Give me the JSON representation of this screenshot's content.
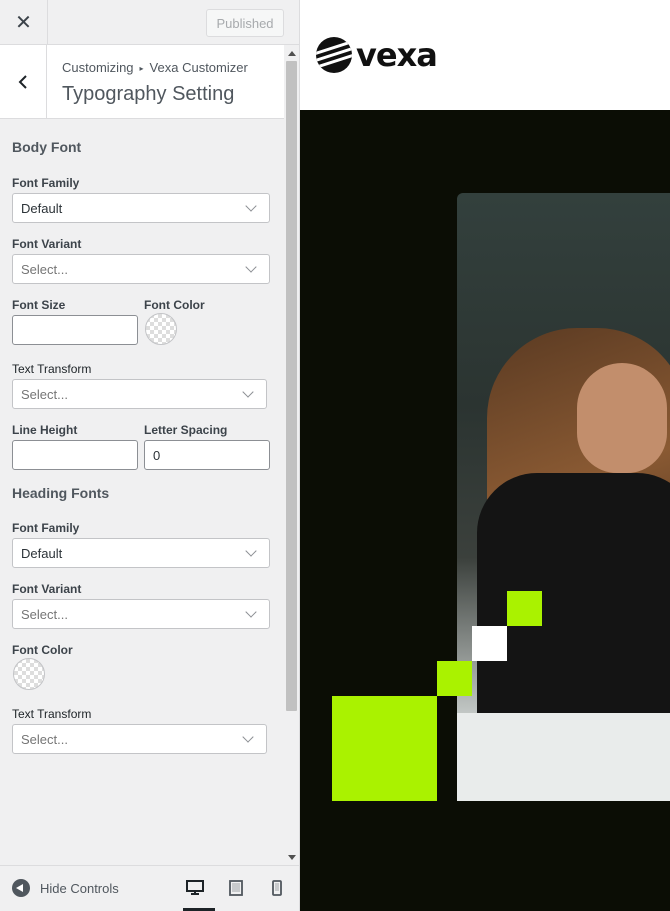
{
  "topbar": {
    "close_glyph": "✕",
    "publish_label": "Published"
  },
  "header": {
    "breadcrumb_root": "Customizing",
    "breadcrumb_sep": "▸",
    "breadcrumb_parent": "Vexa Customizer",
    "title": "Typography Setting"
  },
  "body_font": {
    "title": "Body Font",
    "font_family": {
      "label": "Font Family",
      "value": "Default"
    },
    "font_variant": {
      "label": "Font Variant",
      "placeholder": "Select..."
    },
    "font_size": {
      "label": "Font Size",
      "value": ""
    },
    "font_color": {
      "label": "Font Color"
    },
    "text_transform": {
      "label": "Text Transform",
      "placeholder": "Select..."
    },
    "line_height": {
      "label": "Line Height",
      "value": ""
    },
    "letter_spacing": {
      "label": "Letter Spacing",
      "value": "0"
    }
  },
  "heading_fonts": {
    "title": "Heading Fonts",
    "font_family": {
      "label": "Font Family",
      "value": "Default"
    },
    "font_variant": {
      "label": "Font Variant",
      "placeholder": "Select..."
    },
    "font_color": {
      "label": "Font Color"
    },
    "text_transform": {
      "label": "Text Transform",
      "placeholder": "Select..."
    }
  },
  "footer": {
    "hide_controls_label": "Hide Controls",
    "devices": [
      "desktop-icon",
      "tablet-icon",
      "mobile-icon"
    ],
    "active_device": "desktop"
  },
  "preview": {
    "logo_text": "vexa",
    "accent_color": "#aaf200",
    "hero_bg": "#0b0d05"
  }
}
